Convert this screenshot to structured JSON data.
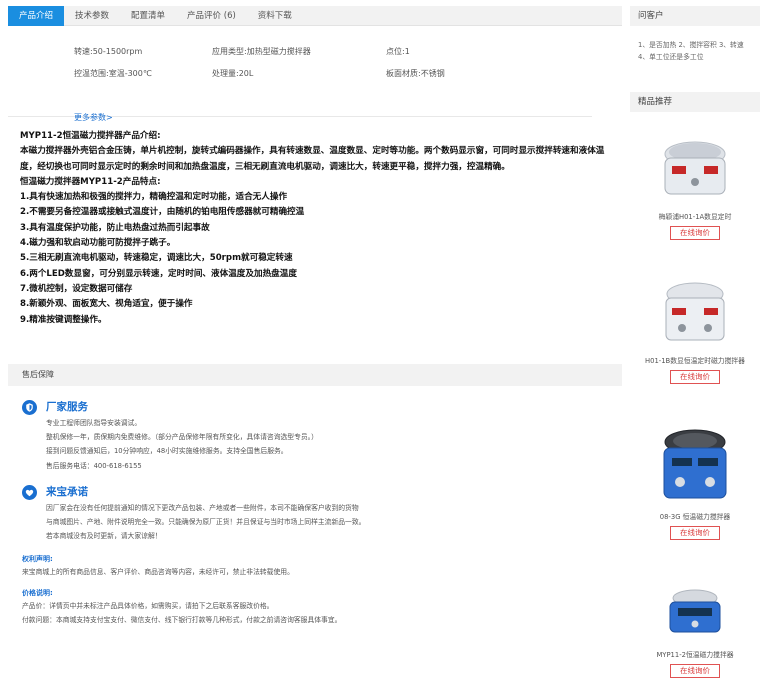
{
  "tabs": [
    "产品介绍",
    "技术参数",
    "配置清单",
    "产品评价 (6)",
    "资料下载"
  ],
  "specs": {
    "row1": [
      "转速:50-1500rpm",
      "应用类型:加热型磁力搅拌器",
      "点位:1"
    ],
    "row2": [
      "控温范围:室温-300℃",
      "处理量:20L",
      "板面材质:不锈钢"
    ],
    "more": "更多参数>"
  },
  "description": [
    "MYP11-2恒温磁力搅拌器产品介绍:",
    "本磁力搅拌器外壳铝合金压铸，单片机控制，旋转式编码器操作，具有转速数显、温度数显、定时等功能。两个数码显示窗，可同时显示搅拌转速和液体温度，经切换也可同时显示定时的剩余时间和加热盘温度，三相无刷直流电机驱动，调速比大，转速更平稳，搅拌力强，控温精确。",
    "恒温磁力搅拌器MYP11-2产品特点:",
    "1.具有快速加热和极强的搅拌力，精确控温和定时功能，适合无人操作",
    "2.不需要另备控温器或接触式温度计，由随机的铂电阻传感器就可精确控温",
    "3.具有温度保护功能，防止电热盘过热而引起事故",
    "4.磁力强和软启动功能可防搅拌子跳子。",
    "5.三相无刷直流电机驱动，转速稳定，调速比大，50rpm就可稳定转速",
    "6.两个LED数显窗，可分别显示转速，定时时间、液体温度及加热盘温度",
    "7.微机控制，设定数据可储存",
    "8.新颖外观、面板宽大、视角适宜，便于操作",
    "9.精准按键调整操作。"
  ],
  "after_sales": {
    "header": "售后保障",
    "factory": {
      "title": "厂家服务",
      "lines": [
        "专业工程师团队指导安装调试。",
        "整机保修一年，质保期内免费维修。（部分产品保修年限有所变化，具体请咨询选型专员。）",
        "接到问题反馈通知后，10分钟响应，48小时实施维修服务。支持全国售后服务。",
        "售后服务电话：400-618-6155"
      ]
    },
    "promise": {
      "title": "来宝承诺",
      "lines": [
        "因厂家会在没有任何提前通知的情况下更改产品包装、产地或者一些附件，本司不能确保客户收到的货物",
        "与商城图片、产地、附件说明完全一致。只能确保为原厂正货！并且保证与当时市场上同样主流新品一致。",
        "若本商城没有及时更新，请大家谅解！"
      ]
    },
    "rights": {
      "title": "权利声明:",
      "line": "来宝商城上的所有商品信息、客户评价、商品咨询等内容，未经许可，禁止非法转载使用。"
    },
    "price": {
      "title": "价格说明:",
      "lines": [
        "产品价：详情页中并未标注产品具体价格，如需购买，请拍下之后联系客服改价格。",
        "付款问题：本商城支持支付宝支付、微信支付、线下银行打款等几种形式，付款之前请咨询客服具体事宜。"
      ]
    }
  },
  "sidebar": {
    "ask_header": "问客户",
    "ask_text": "1、是否加热 2、搅拌容积 3、转速 4、单工位还是多工位",
    "recommend_header": "精品推荐",
    "products": [
      {
        "name": "梅颖浦H01-1A数显定时",
        "button": "在线询价"
      },
      {
        "name": "H01-1B数显恒温定时磁力搅拌器",
        "button": "在线询价"
      },
      {
        "name": "08-3G 恒温磁力搅拌器",
        "button": "在线询价"
      },
      {
        "name": "MYP11-2恒温磁力搅拌器",
        "button": "在线询价"
      }
    ]
  },
  "colors": {
    "accent": "#1a8ee0",
    "link": "#1a6fd0",
    "price_button": "#d83a3a"
  }
}
